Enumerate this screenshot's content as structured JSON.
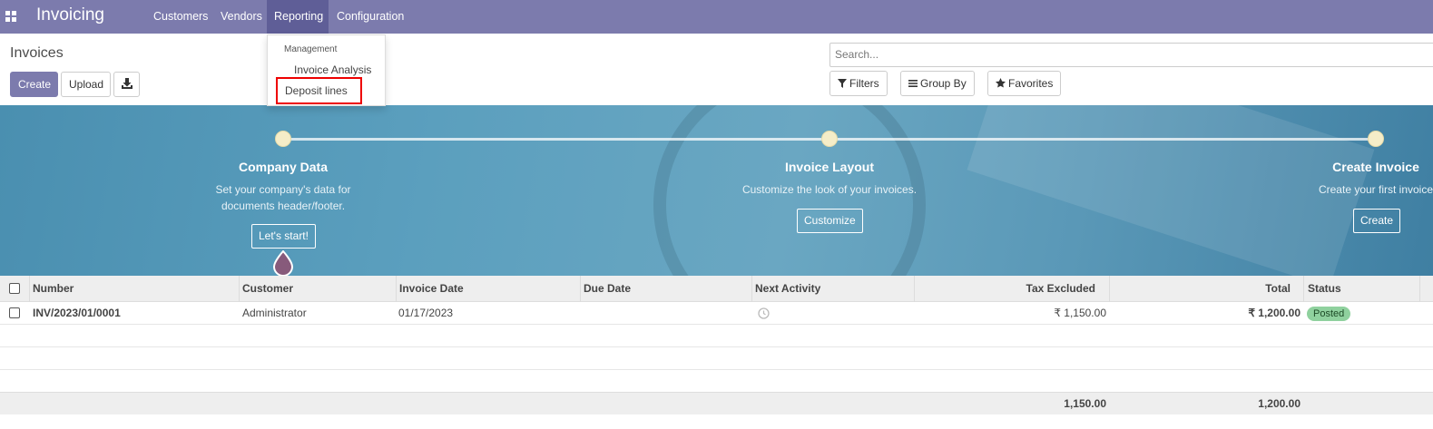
{
  "navbar": {
    "brand": "Invoicing",
    "menu": [
      "Customers",
      "Vendors",
      "Reporting",
      "Configuration"
    ],
    "active": "Reporting",
    "color": "#7c7bad"
  },
  "control_panel": {
    "breadcrumb": "Invoices",
    "create_label": "Create",
    "upload_label": "Upload",
    "download_icon": "download-icon",
    "search_placeholder": "Search...",
    "filters_label": "Filters",
    "groupby_label": "Group By",
    "favorites_label": "Favorites"
  },
  "reporting_dropdown": {
    "header": "Management",
    "items": [
      "Invoice Analysis",
      "Deposit lines"
    ],
    "highlighted": "Deposit lines"
  },
  "onboarding": {
    "steps": [
      {
        "title": "Company Data",
        "desc_lines": [
          "Set your company's data for",
          "documents header/footer."
        ],
        "button": "Let's start!"
      },
      {
        "title": "Invoice Layout",
        "desc_lines": [
          "Customize the look of your invoices."
        ],
        "button": "Customize"
      },
      {
        "title": "Create Invoice",
        "desc_lines": [
          "Create your first invoice"
        ],
        "button": "Create"
      }
    ]
  },
  "table": {
    "columns": [
      "Number",
      "Customer",
      "Invoice Date",
      "Due Date",
      "Next Activity",
      "Tax Excluded",
      "Total",
      "Status"
    ],
    "rows": [
      {
        "number": "INV/2023/01/0001",
        "customer": "Administrator",
        "invoice_date": "01/17/2023",
        "due_date": "",
        "next_activity_icon": "clock-icon",
        "tax_excluded": "₹ 1,150.00",
        "total": "₹ 1,200.00",
        "status": "Posted"
      }
    ],
    "footer": {
      "tax_excluded": "1,150.00",
      "total": "1,200.00"
    }
  }
}
